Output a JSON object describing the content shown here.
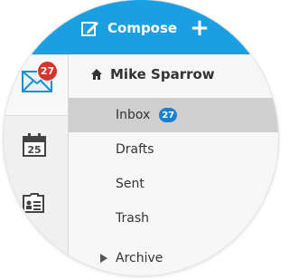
{
  "compose": {
    "label": "Compose"
  },
  "user": {
    "name": "Mike Sparrow"
  },
  "rail": {
    "mail_badge": "27",
    "calendar_day": "25"
  },
  "nav": {
    "items": [
      {
        "label": "Inbox",
        "badge": "27"
      },
      {
        "label": "Drafts"
      },
      {
        "label": "Sent"
      },
      {
        "label": "Trash"
      },
      {
        "label": "Archive"
      }
    ]
  },
  "colors": {
    "accent": "#1aa0e2",
    "badge_red": "#d9342b",
    "badge_blue": "#1780d4",
    "selected_row": "#cfcfcf"
  },
  "icons": [
    "compose-icon",
    "plus-icon",
    "mail-icon",
    "calendar-icon",
    "contacts-icon",
    "home-icon",
    "caret-right-icon"
  ]
}
